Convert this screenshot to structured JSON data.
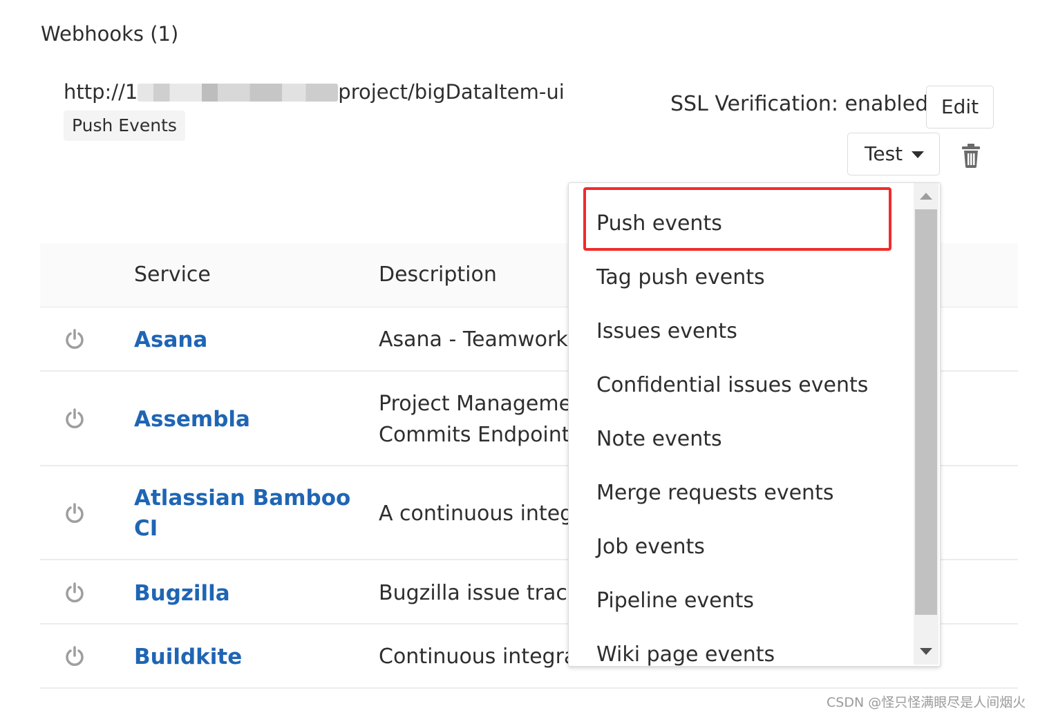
{
  "webhooks": {
    "title": "Webhooks (1)",
    "url_prefix": "http://1",
    "url_suffix": "project/bigDataItem-ui",
    "event_badge": "Push Events",
    "ssl_status": "SSL Verification: enabled",
    "edit_label": "Edit",
    "test_label": "Test"
  },
  "table": {
    "headers": {
      "service": "Service",
      "description": "Description"
    },
    "rows": [
      {
        "service": "Asana",
        "description": [
          "Asana - Teamwork w"
        ]
      },
      {
        "service": "Assembla",
        "description": [
          "Project Managemen",
          "Commits Endpoint)"
        ]
      },
      {
        "service_lines": [
          "Atlassian Bamboo",
          "CI"
        ],
        "description": [
          "A continuous integr"
        ]
      },
      {
        "service": "Bugzilla",
        "description": [
          "Bugzilla issue tracke"
        ]
      },
      {
        "service": "Buildkite",
        "description": [
          "Continuous integrat"
        ]
      }
    ]
  },
  "dropdown": {
    "items": [
      "Push events",
      "Tag push events",
      "Issues events",
      "Confidential issues events",
      "Note events",
      "Merge requests events",
      "Job events",
      "Pipeline events",
      "Wiki page events"
    ],
    "highlighted": "Push events",
    "highlight_color": "#f02b2b"
  },
  "colors": {
    "link": "#1f65b4",
    "text": "#2e2e2e"
  },
  "watermark": "CSDN @怪只怪满眼尽是人间烟火"
}
